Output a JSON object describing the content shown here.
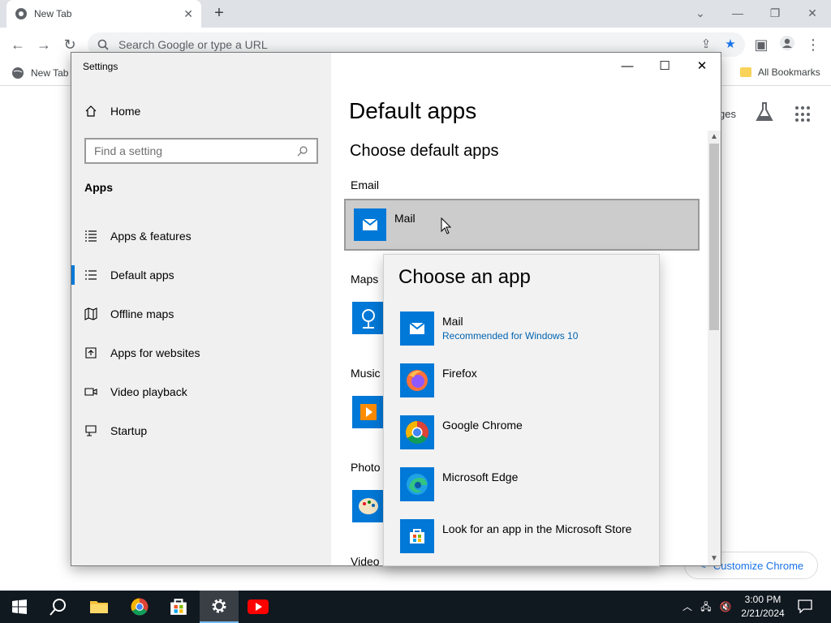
{
  "browser": {
    "tab_title": "New Tab",
    "omnibox_placeholder": "Search Google or type a URL",
    "bookmarks": {
      "first": "New Tab",
      "all": "All Bookmarks"
    },
    "ntp": {
      "images_partial": "ges",
      "customize": "Customize Chrome"
    }
  },
  "settings": {
    "window_title": "Settings",
    "sidebar": {
      "home": "Home",
      "search_placeholder": "Find a setting",
      "section": "Apps",
      "items": [
        {
          "label": "Apps & features",
          "icon": "list-icon",
          "selected": false
        },
        {
          "label": "Default apps",
          "icon": "default-apps-icon",
          "selected": true
        },
        {
          "label": "Offline maps",
          "icon": "map-icon",
          "selected": false
        },
        {
          "label": "Apps for websites",
          "icon": "open-link-icon",
          "selected": false
        },
        {
          "label": "Video playback",
          "icon": "video-icon",
          "selected": false
        },
        {
          "label": "Startup",
          "icon": "startup-icon",
          "selected": false
        }
      ]
    },
    "main": {
      "heading": "Default apps",
      "subheading": "Choose default apps",
      "email_label": "Email",
      "email_app": "Mail",
      "maps_label": "Maps",
      "music_label": "Music",
      "photo_label": "Photo",
      "video_label": "Video"
    }
  },
  "flyout": {
    "title": "Choose an app",
    "options": [
      {
        "name": "Mail",
        "sub": "Recommended for Windows 10",
        "icon": "mail-icon"
      },
      {
        "name": "Firefox",
        "sub": "",
        "icon": "firefox-icon"
      },
      {
        "name": "Google Chrome",
        "sub": "",
        "icon": "chrome-icon"
      },
      {
        "name": "Microsoft Edge",
        "sub": "",
        "icon": "edge-icon"
      },
      {
        "name": "Look for an app in the Microsoft Store",
        "sub": "",
        "icon": "store-icon"
      }
    ]
  },
  "taskbar": {
    "time": "3:00 PM",
    "date": "2/21/2024"
  },
  "colors": {
    "accent": "#0078d7",
    "taskbar": "#101820",
    "chrome_blue": "#1a73e8"
  }
}
